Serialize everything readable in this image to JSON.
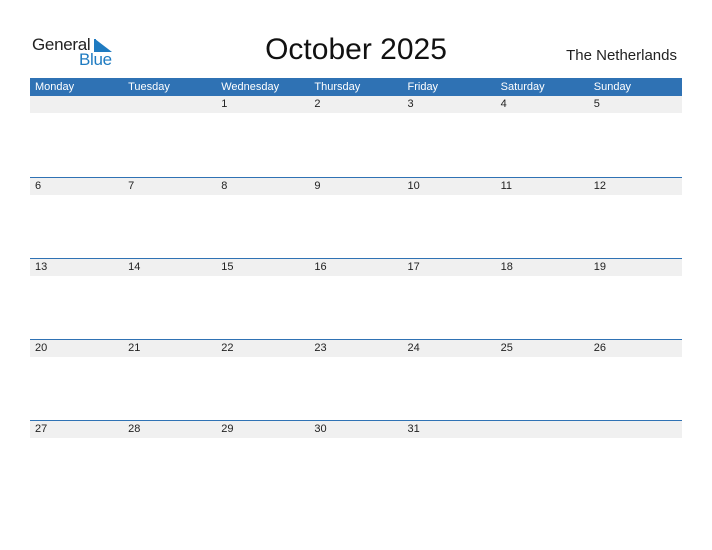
{
  "logo": {
    "general": "General",
    "blue": "Blue",
    "accent_color": "#1f7bc1"
  },
  "title": "October 2025",
  "country": "The Netherlands",
  "header_color": "#2f72b4",
  "weekdays": [
    "Monday",
    "Tuesday",
    "Wednesday",
    "Thursday",
    "Friday",
    "Saturday",
    "Sunday"
  ],
  "weeks": [
    [
      "",
      "",
      "1",
      "2",
      "3",
      "4",
      "5"
    ],
    [
      "6",
      "7",
      "8",
      "9",
      "10",
      "11",
      "12"
    ],
    [
      "13",
      "14",
      "15",
      "16",
      "17",
      "18",
      "19"
    ],
    [
      "20",
      "21",
      "22",
      "23",
      "24",
      "25",
      "26"
    ],
    [
      "27",
      "28",
      "29",
      "30",
      "31",
      "",
      ""
    ]
  ]
}
